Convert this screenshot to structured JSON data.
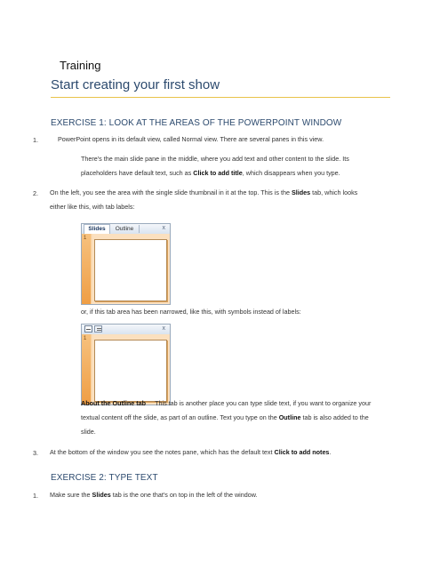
{
  "header": {
    "training": "Training",
    "title": "Start creating your first show"
  },
  "exercise1": {
    "heading": "EXERCISE 1: LOOK AT THE AREAS OF THE POWERPOINT WINDOW",
    "item1": {
      "num": "1.",
      "text": "PowerPoint opens in its default view, called Normal view. There are several panes in this view."
    },
    "para1": {
      "line1": "There's the main slide pane in the middle, where you add text and other content to the slide. Its",
      "line2_pre": "placeholders have default text, such as ",
      "line2_bold": "Click to add title",
      "line2_post": ", which disappears when you type."
    },
    "item2": {
      "num": "2.",
      "line1_pre": "On the left, you see the area with the single slide thumbnail in it at the top. This is the ",
      "line1_bold": "Slides",
      "line1_post": " tab, which looks",
      "line2": "either like this, with tab labels:"
    },
    "pane1": {
      "tab_slides": "Slides",
      "tab_outline": "Outline",
      "close": "x",
      "slide_number": "1",
      "close_icon": "close-icon"
    },
    "narrowed_text": "or, if this tab area has been narrowed, like this, with symbols instead of labels:",
    "pane2": {
      "close": "x",
      "slide_number": "1",
      "slides_icon": "slides-tab-icon",
      "outline_icon": "outline-tab-icon"
    },
    "outline_note": {
      "label": "About the Outline tab",
      "line1": "This tab is another place you can type slide text, if you want to organize your",
      "line2_pre": "textual content off the slide, as part of an outline. Text you type on the ",
      "line2_bold": "Outline",
      "line2_post": " tab is also added to the",
      "line3": "slide."
    },
    "item3": {
      "num": "3.",
      "text_pre": "At the bottom of the window you see the notes pane, which has the default text ",
      "text_bold": "Click to add notes",
      "text_post": "."
    }
  },
  "exercise2": {
    "heading": "EXERCISE 2: TYPE TEXT",
    "item1": {
      "num": "1.",
      "text_pre": "Make sure the ",
      "text_bold": "Slides",
      "text_post": " tab is the one that's on top in the left of the window."
    }
  },
  "colors": {
    "heading": "#2c4a6e",
    "rule": "#e8c34a",
    "pane_frame": "#c9d6e6",
    "slide_strip": "#ef9e45"
  }
}
